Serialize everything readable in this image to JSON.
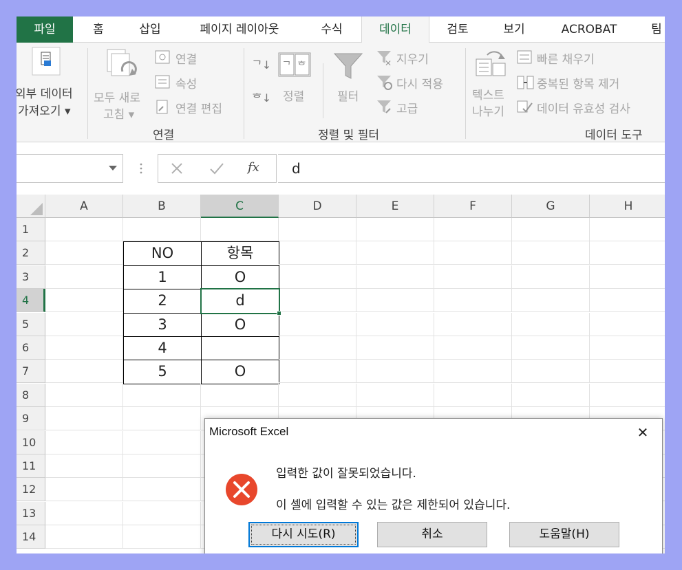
{
  "tabs": [
    {
      "label": "파일"
    },
    {
      "label": "홈"
    },
    {
      "label": "삽입"
    },
    {
      "label": "페이지 레이아웃"
    },
    {
      "label": "수식"
    },
    {
      "label": "데이터"
    },
    {
      "label": "검토"
    },
    {
      "label": "보기"
    },
    {
      "label": "ACROBAT"
    },
    {
      "label": "팀"
    }
  ],
  "active_tab": "데이터",
  "ribbon": {
    "external": {
      "line1": "외부 데이터",
      "line2": "가져오기 ▾"
    },
    "refresh": {
      "line1": "모두 새로",
      "line2": "고침 ▾"
    },
    "connections": {
      "item1": "연결",
      "item2": "속성",
      "item3": "연결 편집",
      "group_label": "연결"
    },
    "sort": {
      "sort_label": "정렬",
      "filter_label": "필터",
      "clear": "지우기",
      "reapply": "다시 적용",
      "advanced": "고급",
      "group_label": "정렬 및 필터"
    },
    "datatools": {
      "text_line1": "텍스트",
      "text_line2": "나누기",
      "flash_fill": "빠른 채우기",
      "remove_dup": "중복된 항목 제거",
      "validation": "데이터 유효성 검사",
      "group_label": "데이터 도구"
    }
  },
  "formula_bar": {
    "fx_label": "fx",
    "value": "d"
  },
  "columns": [
    "A",
    "B",
    "C",
    "D",
    "E",
    "F",
    "G",
    "H"
  ],
  "rows": [
    "1",
    "2",
    "3",
    "4",
    "5",
    "6",
    "7",
    "8",
    "9",
    "10",
    "11",
    "12",
    "13",
    "14"
  ],
  "selected_column": "C",
  "selected_row": "4",
  "table": {
    "header": {
      "b": "NO",
      "c": "항목"
    },
    "rows": [
      {
        "b": "1",
        "c": "O"
      },
      {
        "b": "2",
        "c": "d"
      },
      {
        "b": "3",
        "c": "O"
      },
      {
        "b": "4",
        "c": ""
      },
      {
        "b": "5",
        "c": "O"
      }
    ]
  },
  "dialog": {
    "title": "Microsoft Excel",
    "close_glyph": "✕",
    "message1": "입력한 값이 잘못되었습니다.",
    "message2": "이 셀에 입력할 수 있는 값은 제한되어 있습니다.",
    "retry_label": "다시 시도(R)",
    "cancel_label": "취소",
    "help_label": "도움말(H)"
  },
  "colors": {
    "excel_green": "#217346",
    "error_red": "#e8472c",
    "background": "#9ea4f4"
  }
}
